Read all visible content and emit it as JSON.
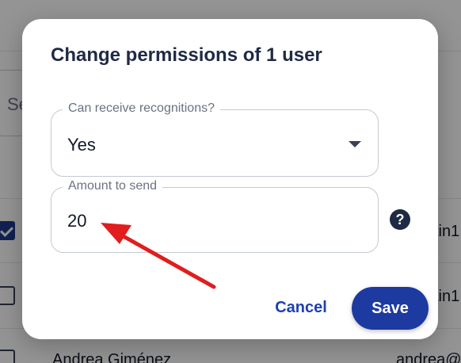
{
  "background": {
    "search_text": "Se",
    "rows": [
      {
        "checked": true,
        "name": "",
        "email": "tin1"
      },
      {
        "checked": false,
        "name": "",
        "email": "tin1"
      },
      {
        "checked": false,
        "name": "Andrea Giménez",
        "email": "andrea@"
      }
    ]
  },
  "dialog": {
    "title": "Change permissions of 1 user",
    "receive_field": {
      "label": "Can receive recognitions?",
      "value": "Yes"
    },
    "amount_field": {
      "label": "Amount to send",
      "value": "20"
    },
    "help_icon": "?",
    "cancel_label": "Cancel",
    "save_label": "Save"
  },
  "colors": {
    "primary": "#1d3aa0",
    "link": "#1e40af",
    "title": "#1f2a44",
    "annotation": "#e11d1d"
  }
}
